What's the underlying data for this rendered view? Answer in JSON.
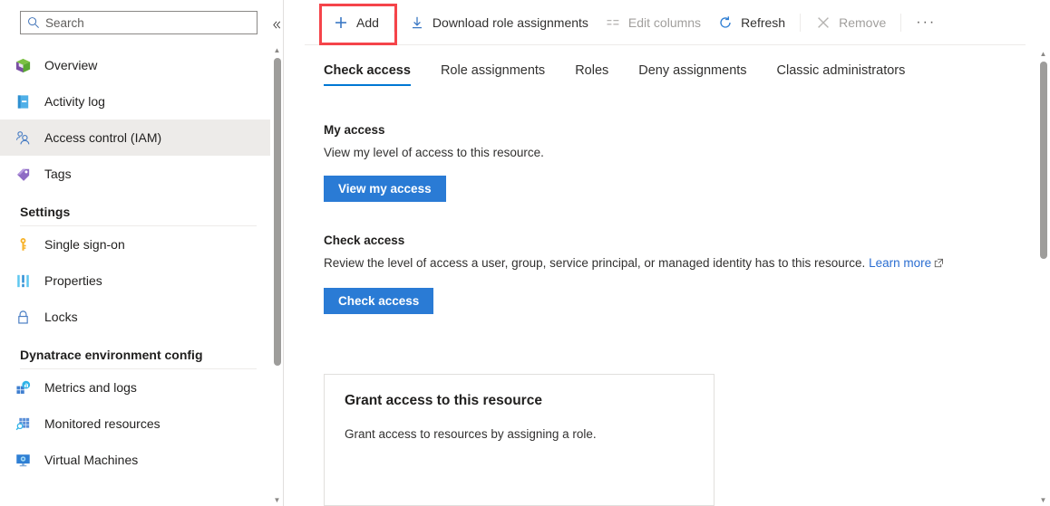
{
  "sidebar": {
    "search": {
      "placeholder": "Search",
      "value": "",
      "icon": "search-icon"
    },
    "collapse_icon": "chevron-double-left-icon",
    "items": [
      {
        "label": "Overview",
        "icon": "cube-icon",
        "selected": false
      },
      {
        "label": "Activity log",
        "icon": "book-icon",
        "selected": false
      },
      {
        "label": "Access control (IAM)",
        "icon": "people-icon",
        "selected": true
      },
      {
        "label": "Tags",
        "icon": "tag-icon",
        "selected": false
      }
    ],
    "groups": [
      {
        "title": "Settings",
        "items": [
          {
            "label": "Single sign-on",
            "icon": "key-icon"
          },
          {
            "label": "Properties",
            "icon": "sliders-icon"
          },
          {
            "label": "Locks",
            "icon": "lock-icon"
          }
        ]
      },
      {
        "title": "Dynatrace environment config",
        "items": [
          {
            "label": "Metrics and logs",
            "icon": "metrics-icon"
          },
          {
            "label": "Monitored resources",
            "icon": "monitored-resources-icon"
          },
          {
            "label": "Virtual Machines",
            "icon": "virtual-machine-icon"
          }
        ]
      }
    ]
  },
  "toolbar": {
    "add_label": "Add",
    "add_icon": "plus-icon",
    "download_label": "Download role assignments",
    "download_icon": "download-icon",
    "edit_columns_label": "Edit columns",
    "edit_columns_icon": "columns-icon",
    "refresh_label": "Refresh",
    "refresh_icon": "refresh-icon",
    "remove_label": "Remove",
    "remove_icon": "close-x-icon",
    "more_label": "···",
    "highlight_color": "#f5444a"
  },
  "tabs": [
    {
      "label": "Check access",
      "active": true
    },
    {
      "label": "Role assignments",
      "active": false
    },
    {
      "label": "Roles",
      "active": false
    },
    {
      "label": "Deny assignments",
      "active": false
    },
    {
      "label": "Classic administrators",
      "active": false
    }
  ],
  "main": {
    "my_access": {
      "title": "My access",
      "description": "View my level of access to this resource.",
      "button_label": "View my access"
    },
    "check_access": {
      "title": "Check access",
      "description": "Review the level of access a user, group, service principal, or managed identity has to this resource. ",
      "link_label": "Learn more",
      "link_icon": "external-link-icon",
      "button_label": "Check access"
    },
    "grant_card": {
      "title": "Grant access to this resource",
      "description": "Grant access to resources by assigning a role."
    }
  },
  "colors": {
    "accent": "#0078d4",
    "button": "#2a7bd5",
    "highlight": "#f5444a",
    "selected_bg": "#edebe9"
  }
}
